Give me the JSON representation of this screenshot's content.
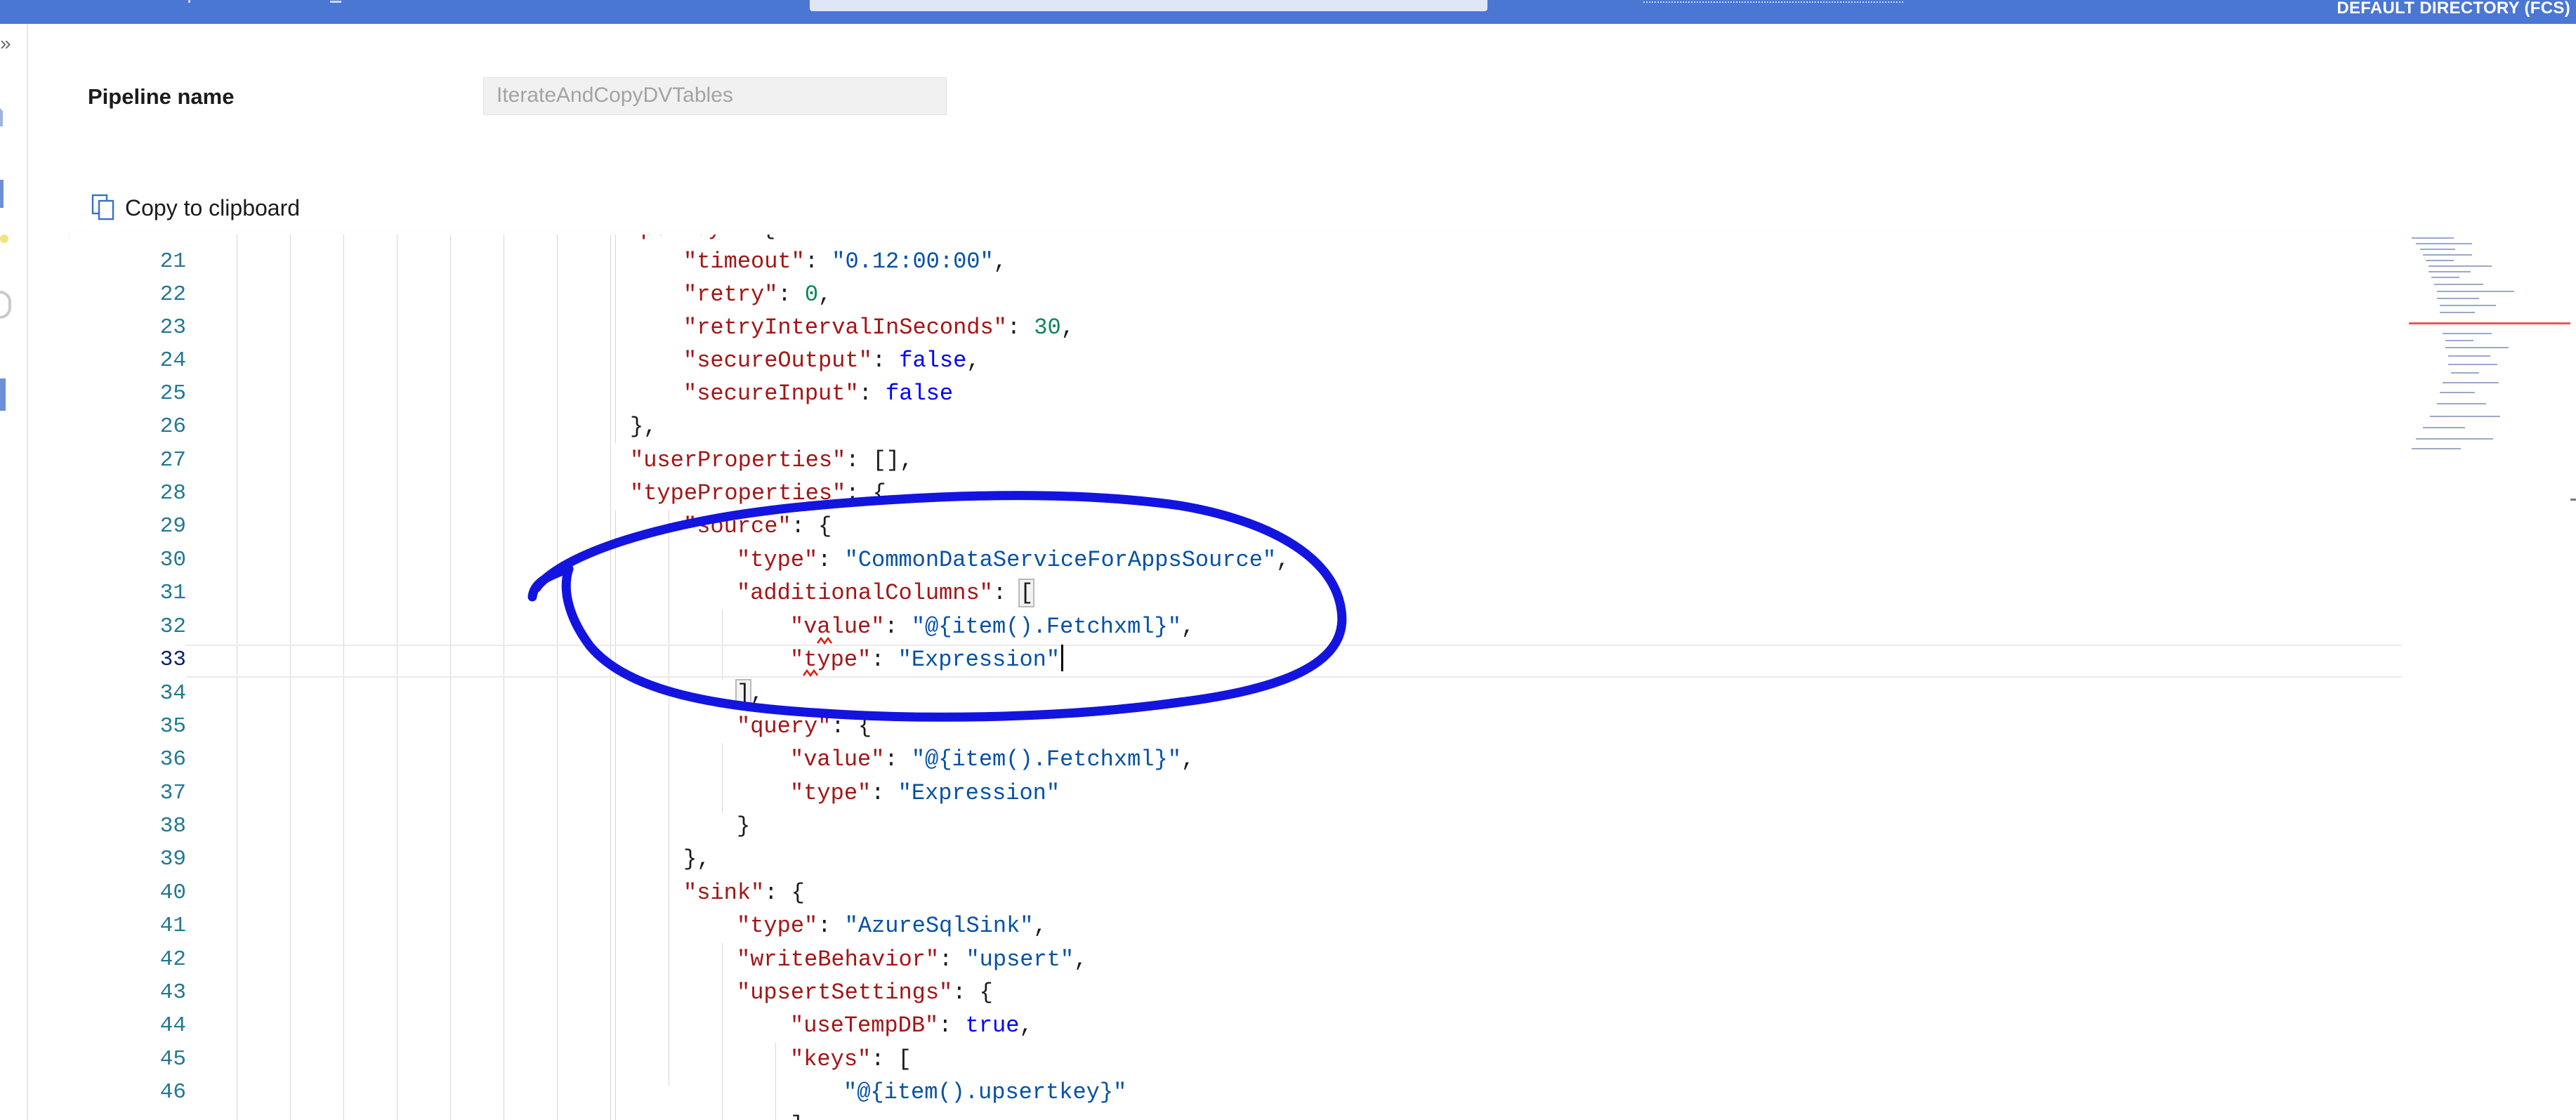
{
  "topbar": {
    "directory": "DEFAULT DIRECTORY (FCS)",
    "accent": "#4a76d4"
  },
  "sidebar": {
    "expand_glyph": "»"
  },
  "header": {
    "pipeline_label": "Pipeline name",
    "pipeline_value": "IterateAndCopyDVTables",
    "copy_label": "Copy to clipboard",
    "copy_icon": "copy-icon"
  },
  "editor": {
    "line_numbers": [
      "21",
      "22",
      "23",
      "24",
      "25",
      "26",
      "27",
      "28",
      "29",
      "30",
      "31",
      "32",
      "33",
      "34",
      "35",
      "36",
      "37",
      "38",
      "39",
      "40",
      "41",
      "42",
      "43",
      "44",
      "45",
      "46"
    ],
    "current_line": "33",
    "tokens": {
      "k_timeout": "\"timeout\"",
      "s_timeout": "\"0.12:00:00\"",
      "k_retry": "\"retry\"",
      "n_retry": "0",
      "k_retryInterval": "\"retryIntervalInSeconds\"",
      "n_retryInterval": "30",
      "k_secureOutput": "\"secureOutput\"",
      "b_secureOutput": "false",
      "k_secureInput": "\"secureInput\"",
      "b_secureInput": "false",
      "k_userProperties": "\"userProperties\"",
      "k_typeProperties": "\"typeProperties\"",
      "k_source": "\"source\"",
      "k_type30": "\"type\"",
      "s_type30": "\"CommonDataServiceForAppsSource\"",
      "k_additionalColumns": "\"additionalColumns\"",
      "k_value32": "\"value\"",
      "s_value32": "\"@{item().Fetchxml}\"",
      "k_type33": "\"type\"",
      "s_type33": "\"Expression\"",
      "k_query": "\"query\"",
      "k_value36": "\"value\"",
      "s_value36": "\"@{item().Fetchxml}\"",
      "k_type37": "\"type\"",
      "s_type37": "\"Expression\"",
      "k_sink": "\"sink\"",
      "k_type41": "\"type\"",
      "s_type41": "\"AzureSqlSink\"",
      "k_writeBehavior": "\"writeBehavior\"",
      "s_writeBehavior": "\"upsert\"",
      "k_upsertSettings": "\"upsertSettings\"",
      "k_useTempDB": "\"useTempDB\"",
      "b_useTempDB": "true",
      "k_keys": "\"keys\"",
      "s_upsertkey": "\"@{item().upsertkey}\""
    }
  },
  "annotation": {
    "color": "#1414e0"
  }
}
